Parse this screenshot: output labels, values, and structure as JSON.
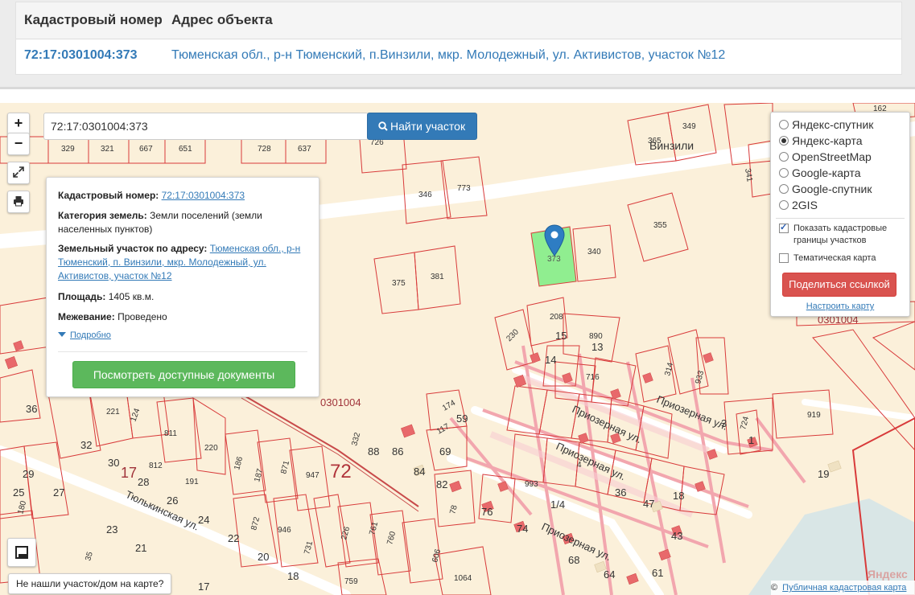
{
  "table": {
    "headers": [
      "Кадастровый номер",
      "Адрес объекта"
    ],
    "row": {
      "cadastral_number": "72:17:0301004:373",
      "address": "Тюменская обл., р-н Тюменский, п.Винзили, мкр. Молодежный, ул. Активистов, участок №12"
    }
  },
  "map_controls": {
    "zoom_in": "+",
    "zoom_out": "−",
    "fullscreen_icon": "fullscreen-icon",
    "print_icon": "print-icon"
  },
  "search": {
    "value": "72:17:0301004:373",
    "button_label": "Найти участок",
    "button_icon": "search-icon"
  },
  "info_card": {
    "cadastral_label": "Кадастровый номер:",
    "cadastral_value": "72:17:0301004:373",
    "category_label": "Категория земель:",
    "category_value": "Земли поселений (земли населенных пунктов)",
    "address_label": "Земельный участок по адресу:",
    "address_value": "Тюменская обл., р-н Тюменский, п. Винзили, мкр. Молодежный, ул. Активистов, участок №12",
    "area_label": "Площадь:",
    "area_value": "1405 кв.м.",
    "survey_label": "Межевание:",
    "survey_value": "Проведено",
    "more_link": "Подробно",
    "docs_button": "Посмотреть доступные документы"
  },
  "layers": {
    "options": [
      {
        "label": "Яндекс-спутник",
        "selected": false
      },
      {
        "label": "Яндекс-карта",
        "selected": true
      },
      {
        "label": "OpenStreetMap",
        "selected": false
      },
      {
        "label": "Google-карта",
        "selected": false
      },
      {
        "label": "Google-спутник",
        "selected": false
      },
      {
        "label": "2GIS",
        "selected": false
      }
    ],
    "checks": [
      {
        "label": "Показать кадастровые границы участков",
        "checked": true
      },
      {
        "label": "Тематическая карта",
        "checked": false
      }
    ],
    "share_button": "Поделиться ссылкой",
    "config_link": "Настроить карту"
  },
  "map_labels": {
    "village": "Винзили",
    "district_number": "72",
    "quarter_1": "0301004",
    "quarter_2": "0301004",
    "selected_parcel": "373",
    "street_tyulkinskaya": "Тюлькинская ул.",
    "street_priozernaya_1": "Приозерная ул.",
    "street_priozernaya_2": "Приозерная ул.",
    "street_priozernaya_3": "Приозерная ул.",
    "street_priozernaya_4": "Приозерная ул.",
    "big_17": "17",
    "parcels_top": [
      "329",
      "321",
      "667",
      "651",
      "728",
      "637",
      "726",
      "365",
      "349",
      "162",
      "341",
      "346",
      "773",
      "355",
      "340",
      "375",
      "381"
    ],
    "parcels_mid": [
      "208",
      "230",
      "15",
      "890",
      "13",
      "14",
      "716",
      "314",
      "933",
      "36",
      "221",
      "124",
      "811",
      "220",
      "32",
      "812",
      "191",
      "186",
      "187",
      "871",
      "947",
      "332",
      "88",
      "86",
      "174",
      "59",
      "117",
      "69",
      "84",
      "82",
      "3",
      "724",
      "1",
      "919",
      "19"
    ],
    "parcels_low": [
      "29",
      "25",
      "27",
      "180",
      "23",
      "35",
      "21",
      "17",
      "18",
      "20",
      "22",
      "24",
      "26",
      "28",
      "30",
      "872",
      "946",
      "731",
      "226",
      "759",
      "761",
      "760",
      "606",
      "1064",
      "36",
      "47",
      "18",
      "43",
      "61",
      "64",
      "68",
      "74",
      "76",
      "78",
      "993",
      "1/4",
      "4"
    ]
  },
  "bottom": {
    "not_found_button": "Не нашли участок/дом на карте?",
    "layers_icon": "map-layers-icon"
  },
  "attribution": {
    "copyright": "©",
    "link": "Публичная кадастровая карта",
    "watermark": "Яндекс"
  },
  "colors": {
    "primary": "#337ab7",
    "success": "#5cb85c",
    "danger": "#d9534f",
    "parcel_line": "#d83a3a",
    "selected_parcel_fill": "#90ee90",
    "map_bg": "#fbf0da",
    "road": "#ffffff"
  }
}
